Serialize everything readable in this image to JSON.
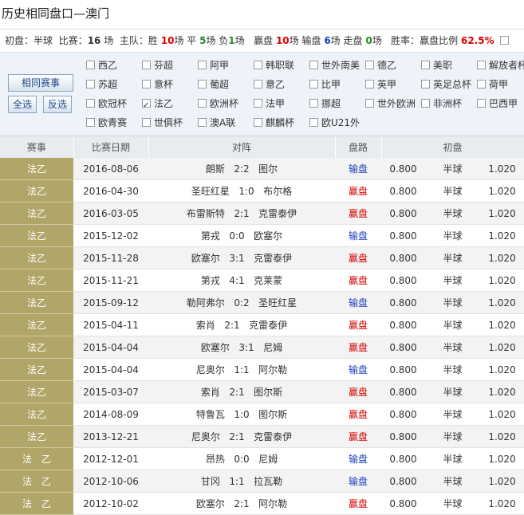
{
  "header": {
    "title": "历史相同盘口—澳门"
  },
  "summary": {
    "chupan_label": "初盘：",
    "chupan_value": "半球",
    "bisai_label": "比赛：",
    "bisai_count": "16",
    "chang": "场",
    "zhuchang_label": "主队：",
    "sheng_label": "胜",
    "sheng_count": "10",
    "sheng_suffix": "场 平",
    "ping_count": "5",
    "ping_suffix": "场 负",
    "fu_count": "1",
    "fu_suffix": "场",
    "yingpan_label": "赢盘",
    "yingpan_count": "10",
    "yingpan_suffix": "场 输盘",
    "shupan_count": "6",
    "shupan_suffix": "场 走盘",
    "zoupan_count": "0",
    "zoupan_suffix": "场",
    "shenglv_label": "胜率：",
    "shenglv_text": "赢盘比例",
    "shenglv_value": "62.5%"
  },
  "filter": {
    "same_match_button": "相同赛事",
    "select_all_button": "全选",
    "invert_button": "反选",
    "leagues": [
      {
        "label": "西乙",
        "checked": false
      },
      {
        "label": "芬超",
        "checked": false
      },
      {
        "label": "阿甲",
        "checked": false
      },
      {
        "label": "韩职联",
        "checked": false
      },
      {
        "label": "世外南美",
        "checked": false
      },
      {
        "label": "德乙",
        "checked": false
      },
      {
        "label": "美职",
        "checked": false
      },
      {
        "label": "解放者杯",
        "checked": false
      },
      {
        "label": "苏超",
        "checked": false
      },
      {
        "label": "意杯",
        "checked": false
      },
      {
        "label": "葡超",
        "checked": false
      },
      {
        "label": "意乙",
        "checked": false
      },
      {
        "label": "比甲",
        "checked": false
      },
      {
        "label": "英甲",
        "checked": false
      },
      {
        "label": "英足总杯",
        "checked": false
      },
      {
        "label": "荷甲",
        "checked": false
      },
      {
        "label": "欧冠杯",
        "checked": false
      },
      {
        "label": "法乙",
        "checked": true
      },
      {
        "label": "欧洲杯",
        "checked": false
      },
      {
        "label": "法甲",
        "checked": false
      },
      {
        "label": "挪超",
        "checked": false
      },
      {
        "label": "世外欧洲",
        "checked": false
      },
      {
        "label": "非洲杯",
        "checked": false
      },
      {
        "label": "巴西甲",
        "checked": false
      },
      {
        "label": "欧青赛",
        "checked": false
      },
      {
        "label": "世俱杯",
        "checked": false
      },
      {
        "label": "澳A联",
        "checked": false
      },
      {
        "label": "麒麟杯",
        "checked": false
      },
      {
        "label": "欧U21外",
        "checked": false
      }
    ]
  },
  "table": {
    "headers": [
      "赛事",
      "比赛日期",
      "对阵",
      "盘路",
      "初盘"
    ],
    "rows": [
      {
        "league": "法乙",
        "date": "2016-08-06",
        "home": "朗斯",
        "score": "2:2",
        "away": "图尔",
        "result": "输盘",
        "type": "shu",
        "o1": "0.800",
        "line": "半球",
        "o2": "1.020"
      },
      {
        "league": "法乙",
        "date": "2016-04-30",
        "home": "圣旺红星",
        "score": "1:0",
        "away": "布尔格",
        "result": "赢盘",
        "type": "ying",
        "o1": "0.800",
        "line": "半球",
        "o2": "1.020"
      },
      {
        "league": "法乙",
        "date": "2016-03-05",
        "home": "布雷斯特",
        "score": "2:1",
        "away": "克雷泰伊",
        "result": "赢盘",
        "type": "ying",
        "o1": "0.800",
        "line": "半球",
        "o2": "1.020"
      },
      {
        "league": "法乙",
        "date": "2015-12-02",
        "home": "第戎",
        "score": "0:0",
        "away": "欧塞尔",
        "result": "输盘",
        "type": "shu",
        "o1": "0.800",
        "line": "半球",
        "o2": "1.020"
      },
      {
        "league": "法乙",
        "date": "2015-11-28",
        "home": "欧塞尔",
        "score": "3:1",
        "away": "克雷泰伊",
        "result": "赢盘",
        "type": "ying",
        "o1": "0.800",
        "line": "半球",
        "o2": "1.020"
      },
      {
        "league": "法乙",
        "date": "2015-11-21",
        "home": "第戎",
        "score": "4:1",
        "away": "克莱蒙",
        "result": "赢盘",
        "type": "ying",
        "o1": "0.800",
        "line": "半球",
        "o2": "1.020"
      },
      {
        "league": "法乙",
        "date": "2015-09-12",
        "home": "勒阿弗尔",
        "score": "0:2",
        "away": "圣旺红星",
        "result": "输盘",
        "type": "shu",
        "o1": "0.800",
        "line": "半球",
        "o2": "1.020"
      },
      {
        "league": "法乙",
        "date": "2015-04-11",
        "home": "索肖",
        "score": "2:1",
        "away": "克雷泰伊",
        "result": "赢盘",
        "type": "ying",
        "o1": "0.800",
        "line": "半球",
        "o2": "1.020"
      },
      {
        "league": "法乙",
        "date": "2015-04-04",
        "home": "欧塞尔",
        "score": "3:1",
        "away": "尼姆",
        "result": "赢盘",
        "type": "ying",
        "o1": "0.800",
        "line": "半球",
        "o2": "1.020"
      },
      {
        "league": "法乙",
        "date": "2015-04-04",
        "home": "尼奥尔",
        "score": "1:1",
        "away": "阿尔勒",
        "result": "输盘",
        "type": "shu",
        "o1": "0.800",
        "line": "半球",
        "o2": "1.020"
      },
      {
        "league": "法乙",
        "date": "2015-03-07",
        "home": "索肖",
        "score": "2:1",
        "away": "图尔斯",
        "result": "赢盘",
        "type": "ying",
        "o1": "0.800",
        "line": "半球",
        "o2": "1.020"
      },
      {
        "league": "法乙",
        "date": "2014-08-09",
        "home": "特鲁瓦",
        "score": "1:0",
        "away": "图尔斯",
        "result": "赢盘",
        "type": "ying",
        "o1": "0.800",
        "line": "半球",
        "o2": "1.020"
      },
      {
        "league": "法乙",
        "date": "2013-12-21",
        "home": "尼奥尔",
        "score": "2:1",
        "away": "克雷泰伊",
        "result": "赢盘",
        "type": "ying",
        "o1": "0.800",
        "line": "半球",
        "o2": "1.020"
      },
      {
        "league": "法　乙",
        "date": "2012-12-01",
        "home": "昂热",
        "score": "0:0",
        "away": "尼姆",
        "result": "输盘",
        "type": "shu",
        "o1": "0.800",
        "line": "半球",
        "o2": "1.020"
      },
      {
        "league": "法　乙",
        "date": "2012-10-06",
        "home": "甘冈",
        "score": "1:1",
        "away": "拉瓦勒",
        "result": "输盘",
        "type": "shu",
        "o1": "0.800",
        "line": "半球",
        "o2": "1.020"
      },
      {
        "league": "法　乙",
        "date": "2012-10-02",
        "home": "欧塞尔",
        "score": "2:1",
        "away": "阿尔勒",
        "result": "赢盘",
        "type": "ying",
        "o1": "0.800",
        "line": "半球",
        "o2": "1.020"
      }
    ]
  },
  "colors": {
    "league_cell": "#b1a66a",
    "win": "#d40000",
    "lose": "#1d3fbf",
    "ratio": "#d00"
  }
}
